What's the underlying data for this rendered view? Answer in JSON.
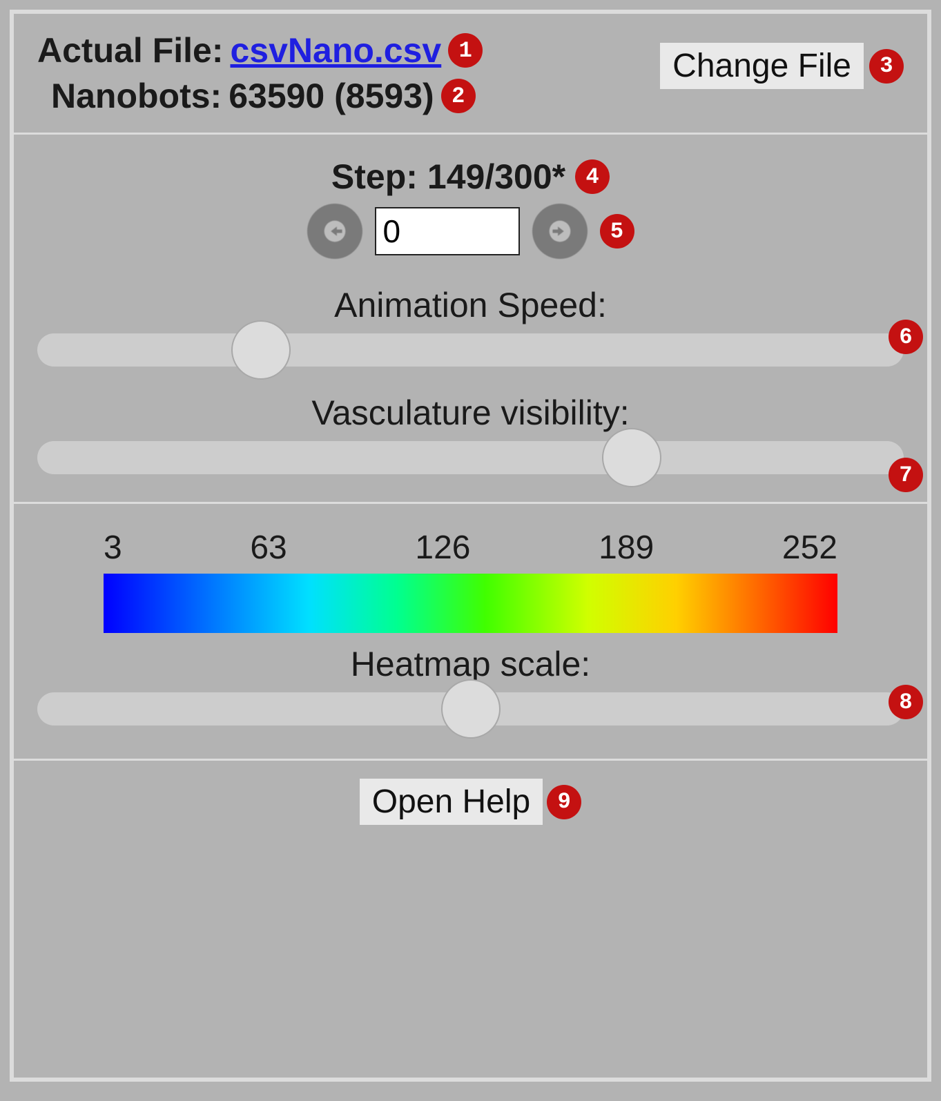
{
  "top": {
    "file_prefix": "Actual File: ",
    "file_name": "csvNano.csv",
    "nano_prefix": "Nanobots: ",
    "nano_value": "63590 (8593)",
    "change_file_label": "Change File"
  },
  "step": {
    "label_prefix": "Step: ",
    "label_value": "149/300*",
    "input_value": "0",
    "anim_label": "Animation Speed:",
    "anim_value": 24,
    "vasc_label": "Vasculature visibility:",
    "vasc_value": 70
  },
  "heat": {
    "ticks": [
      "3",
      "63",
      "126",
      "189",
      "252"
    ],
    "label": "Heatmap scale:",
    "value": 50
  },
  "help": {
    "label": "Open Help"
  },
  "badges": {
    "b1": "1",
    "b2": "2",
    "b3": "3",
    "b4": "4",
    "b5": "5",
    "b6": "6",
    "b7": "7",
    "b8": "8",
    "b9": "9"
  }
}
